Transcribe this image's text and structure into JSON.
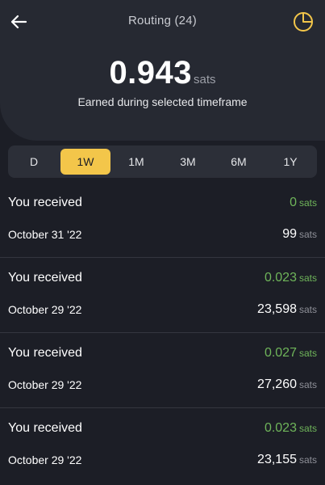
{
  "header": {
    "title": "Routing (24)",
    "back_icon": "back-arrow-icon",
    "stats_icon": "pie-chart-icon",
    "accent": "#f3c64a"
  },
  "summary": {
    "value": "0.943",
    "unit": "sats",
    "caption": "Earned during selected timeframe"
  },
  "timeframes": {
    "selected": "1W",
    "items": [
      "D",
      "1W",
      "1M",
      "3M",
      "6M",
      "1Y"
    ]
  },
  "events": [
    {
      "label": "You received",
      "amount": "0",
      "amount_unit": "sats",
      "date": "October 31 '22",
      "fee": "99",
      "fee_unit": "sats"
    },
    {
      "label": "You received",
      "amount": "0.023",
      "amount_unit": "sats",
      "date": "October 29 '22",
      "fee": "23,598",
      "fee_unit": "sats"
    },
    {
      "label": "You received",
      "amount": "0.027",
      "amount_unit": "sats",
      "date": "October 29 '22",
      "fee": "27,260",
      "fee_unit": "sats"
    },
    {
      "label": "You received",
      "amount": "0.023",
      "amount_unit": "sats",
      "date": "October 29 '22",
      "fee": "23,155",
      "fee_unit": "sats"
    }
  ],
  "colors": {
    "background": "#1c1e26",
    "panel": "#262932",
    "positive": "#6fb55a"
  }
}
